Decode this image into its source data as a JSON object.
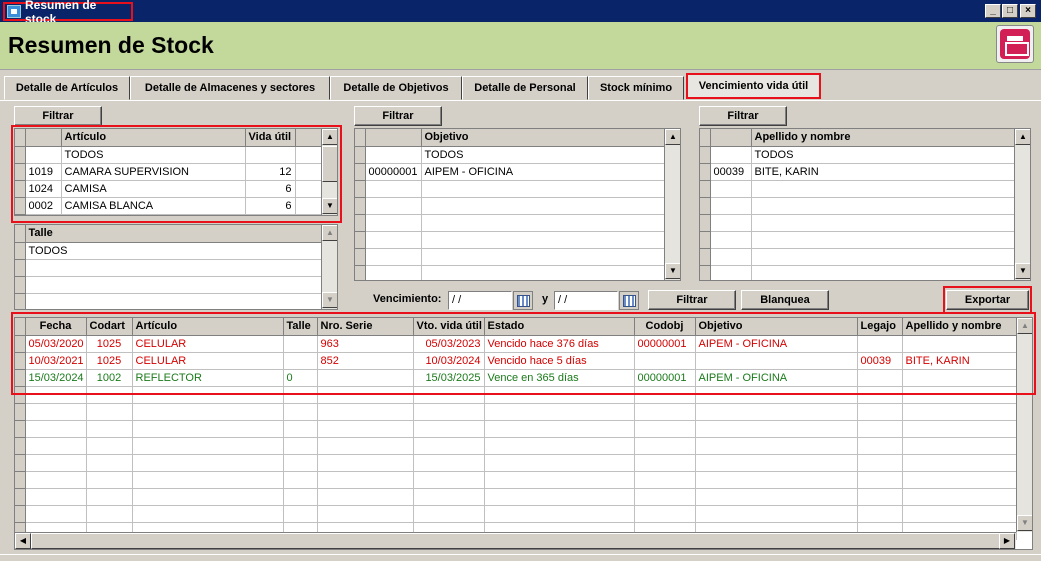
{
  "window": {
    "title": "Resumen de stock",
    "buttons": [
      "_",
      "□",
      "×"
    ]
  },
  "header": {
    "title": "Resumen de Stock"
  },
  "tabs": [
    {
      "label": "Detalle de Artículos"
    },
    {
      "label": "Detalle de Almacenes y sectores"
    },
    {
      "label": "Detalle de Objetivos"
    },
    {
      "label": "Detalle de Personal"
    },
    {
      "label": "Stock mínimo"
    },
    {
      "label": "Vencimiento vida útil"
    }
  ],
  "buttons": {
    "filtrar": "Filtrar",
    "blanquea": "Blanquea",
    "exportar": "Exportar"
  },
  "articulos": {
    "headers": [
      "Artículo",
      "Vida útil"
    ],
    "rows": [
      {
        "code": "",
        "name": "TODOS",
        "vida": ""
      },
      {
        "code": "1019",
        "name": "CAMARA SUPERVISION",
        "vida": "12"
      },
      {
        "code": "1024",
        "name": "CAMISA",
        "vida": "6"
      },
      {
        "code": "0002",
        "name": "CAMISA BLANCA",
        "vida": "6"
      }
    ]
  },
  "talle": {
    "header": "Talle",
    "rows": [
      "TODOS"
    ]
  },
  "objetivos": {
    "header": "Objetivo",
    "rows": [
      {
        "code": "",
        "name": "TODOS"
      },
      {
        "code": "00000001",
        "name": "AIPEM - OFICINA"
      }
    ]
  },
  "personal": {
    "header": "Apellido y nombre",
    "rows": [
      {
        "code": "",
        "name": "TODOS"
      },
      {
        "code": "00039",
        "name": "BITE, KARIN"
      }
    ]
  },
  "vencimiento": {
    "label": "Vencimiento:",
    "y_label": "y",
    "desde": " / /",
    "hasta": " / /"
  },
  "results": {
    "headers": [
      "Fecha",
      "Codart",
      "Artículo",
      "Talle",
      "Nro. Serie",
      "Vto. vida útil",
      "Estado",
      "Codobj",
      "Objetivo",
      "Legajo",
      "Apellido y nombre"
    ],
    "rows": [
      {
        "status": "red",
        "cells": [
          "05/03/2020",
          "1025",
          "CELULAR",
          "",
          "963",
          "05/03/2023",
          "Vencido hace 376 días",
          "00000001",
          "AIPEM - OFICINA",
          "",
          ""
        ]
      },
      {
        "status": "red",
        "cells": [
          "10/03/2021",
          "1025",
          "CELULAR",
          "",
          "852",
          "10/03/2024",
          "Vencido hace 5 días",
          "",
          "",
          "00039",
          "BITE, KARIN"
        ]
      },
      {
        "status": "green",
        "cells": [
          "15/03/2024",
          "1002",
          "REFLECTOR",
          "0",
          "",
          "15/03/2025",
          "Vence en 365 días",
          "00000001",
          "AIPEM - OFICINA",
          "",
          ""
        ]
      }
    ]
  },
  "colors": {
    "header_bg": "#c3d89b",
    "expired": "#d40000",
    "ok": "#1a7a1a",
    "highlight": "#e8101a"
  }
}
